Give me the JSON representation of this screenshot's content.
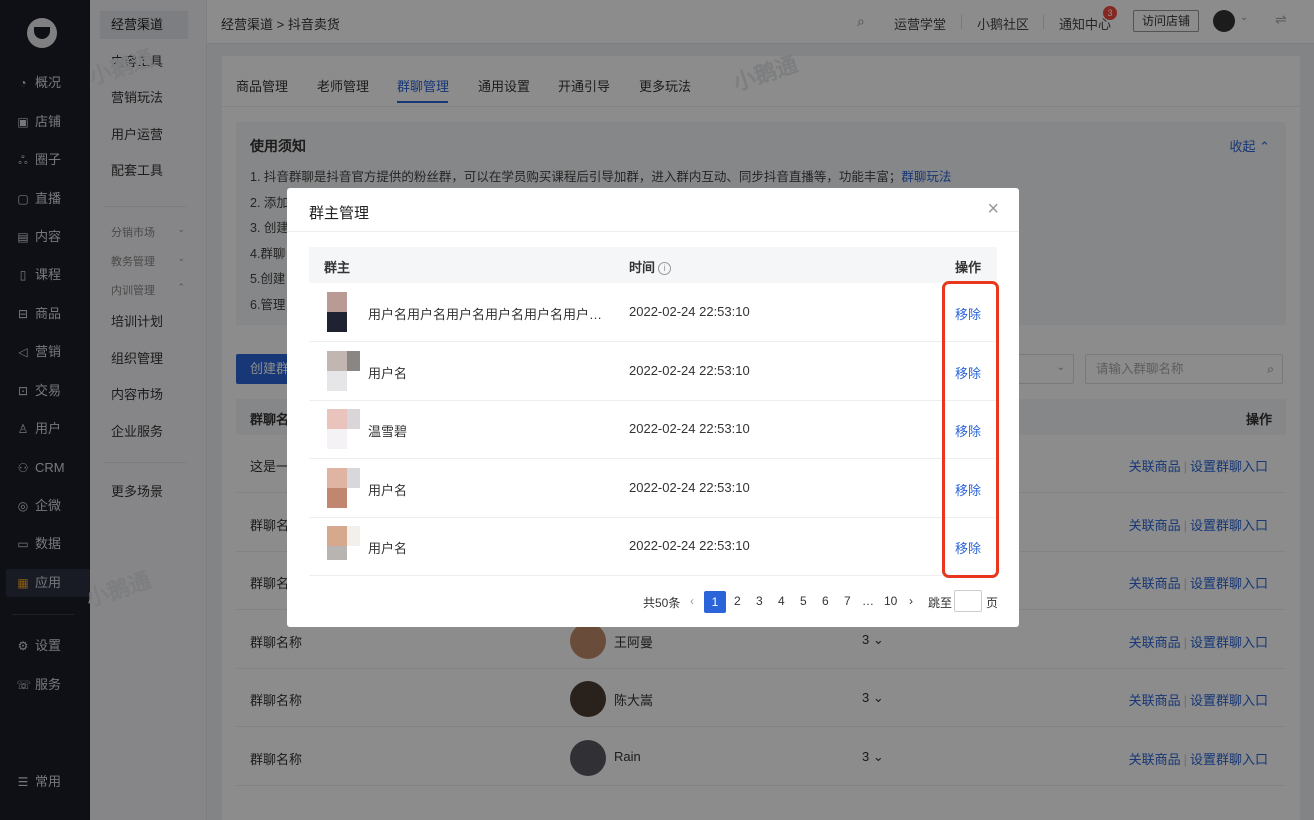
{
  "nav1": {
    "items": [
      {
        "label": "概况",
        "icon": "pie-icon",
        "glyph": "◔"
      },
      {
        "label": "店铺",
        "icon": "store-icon",
        "glyph": "▣"
      },
      {
        "label": "圈子",
        "icon": "people-icon",
        "glyph": "ஃ"
      },
      {
        "label": "直播",
        "icon": "live-icon",
        "glyph": "▢"
      },
      {
        "label": "内容",
        "icon": "document-icon",
        "glyph": "▤"
      },
      {
        "label": "课程",
        "icon": "book-icon",
        "glyph": "▯"
      },
      {
        "label": "商品",
        "icon": "goods-icon",
        "glyph": "⊟"
      },
      {
        "label": "营销",
        "icon": "megaphone-icon",
        "glyph": "◁"
      },
      {
        "label": "交易",
        "icon": "trade-icon",
        "glyph": "⊡"
      },
      {
        "label": "用户",
        "icon": "user-icon",
        "glyph": "♙"
      },
      {
        "label": "CRM",
        "icon": "crm-icon",
        "glyph": "⚇"
      },
      {
        "label": "企微",
        "icon": "wecom-icon",
        "glyph": "◎"
      },
      {
        "label": "数据",
        "icon": "data-icon",
        "glyph": "▭"
      },
      {
        "label": "应用",
        "icon": "apps-icon",
        "glyph": "▦"
      },
      {
        "label": "设置",
        "icon": "gear-icon",
        "glyph": "⚙"
      },
      {
        "label": "服务",
        "icon": "service-icon",
        "glyph": "☏"
      },
      {
        "label": "常用",
        "icon": "menu-icon",
        "glyph": "☰"
      }
    ]
  },
  "nav2": {
    "items": [
      "经营渠道",
      "内容工具",
      "营销玩法",
      "用户运营",
      "配套工具"
    ],
    "groups": [
      "分销市场",
      "教务管理",
      "内训管理"
    ],
    "sub": [
      "培训计划",
      "组织管理",
      "内容市场",
      "企业服务"
    ],
    "more": "更多场景"
  },
  "header": {
    "breadcrumb": "经营渠道 > 抖音卖货",
    "search_glyph": "⌕",
    "links": [
      "运营学堂",
      "小鹅社区",
      "通知中心"
    ],
    "notify_count": "3",
    "visit_store": "访问店铺",
    "chev": "⌄",
    "swap": "⇌"
  },
  "tabs": [
    "商品管理",
    "老师管理",
    "群聊管理",
    "通用设置",
    "开通引导",
    "更多玩法"
  ],
  "notice": {
    "title": "使用须知",
    "collapse": "收起 ⌃",
    "lines": [
      "1. 抖音群聊是抖音官方提供的粉丝群，可以在学员购买课程后引导加群，进入群内互动、同步抖音直播等，功能丰富；",
      "2. 添加",
      "3. 创建",
      "4.群聊",
      "5.创建",
      "6.管理"
    ],
    "link": "群聊玩法"
  },
  "toolbar": {
    "create": "创建群",
    "search_placeholder": "请输入群聊名称",
    "search_glyph": "⌕",
    "select_chev": "⌄"
  },
  "table": {
    "col_name": "群聊名",
    "col_ops": "操作",
    "op1": "关联商品",
    "op2": "设置群聊入口",
    "rows": [
      {
        "name": "这是一",
        "owner": "",
        "count": ""
      },
      {
        "name": "群聊名",
        "owner": "",
        "count": ""
      },
      {
        "name": "群聊名",
        "owner": "",
        "count": ""
      },
      {
        "name": "群聊名称",
        "owner": "王阿曼",
        "count": "3 ⌄"
      },
      {
        "name": "群聊名称",
        "owner": "陈大嵩",
        "count": "3 ⌄"
      },
      {
        "name": "群聊名称",
        "owner": "Rain",
        "count": "3 ⌄"
      }
    ]
  },
  "modal": {
    "title": "群主管理",
    "close": "×",
    "col_owner": "群主",
    "col_time": "时间",
    "info_glyph": "i",
    "col_ops": "操作",
    "remove": "移除",
    "rows": [
      {
        "name": "用户名用户名用户名用户名用户名用户名用户名",
        "time": "2022-02-24 22:53:10"
      },
      {
        "name": "用户名",
        "time": "2022-02-24 22:53:10"
      },
      {
        "name": "温雪碧",
        "time": "2022-02-24 22:53:10"
      },
      {
        "name": "用户名",
        "time": "2022-02-24 22:53:10"
      },
      {
        "name": "用户名",
        "time": "2022-02-24 22:53:10"
      }
    ],
    "pager": {
      "total": "共50条",
      "prev": "‹",
      "pages": [
        "1",
        "2",
        "3",
        "4",
        "5",
        "6",
        "7",
        "…",
        "10"
      ],
      "next": "›",
      "jump_label": "跳至",
      "page_unit": "页"
    }
  },
  "watermark": "小鹅通",
  "colors": {
    "accent": "#2a64d8",
    "highlight": "#e8371c",
    "badge": "#f24a3d"
  }
}
